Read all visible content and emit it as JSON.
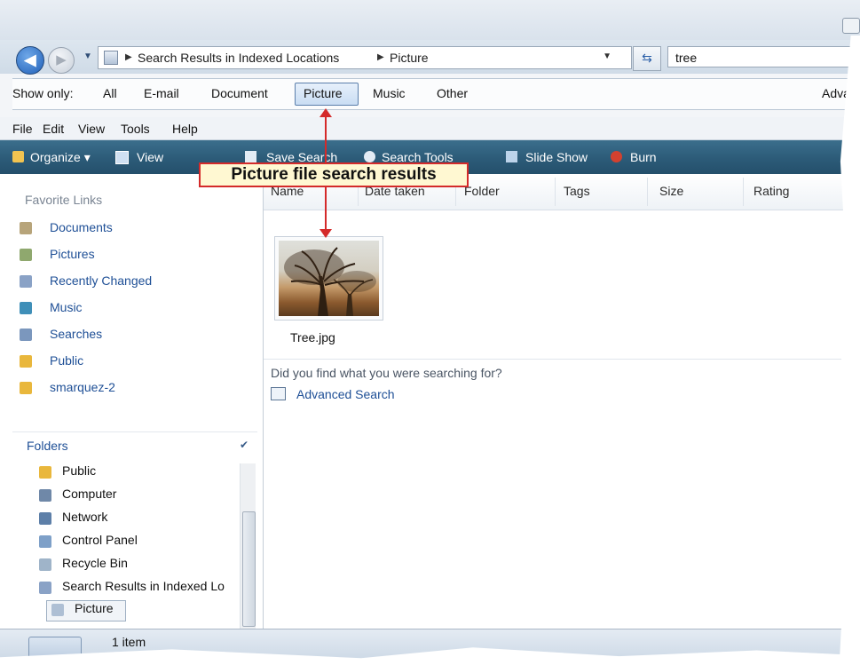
{
  "address": {
    "crumbs": [
      "Search Results in Indexed Locations",
      "Picture"
    ],
    "search_value": "tree"
  },
  "show_only": {
    "label": "Show only:",
    "items": [
      "All",
      "E-mail",
      "Document",
      "Picture",
      "Music",
      "Other"
    ],
    "selected": "Picture",
    "advanced": "Advan"
  },
  "menu": [
    "File",
    "Edit",
    "View",
    "Tools",
    "Help"
  ],
  "toolbar": {
    "organize": "Organize",
    "views": "View",
    "save_search": "Save Search",
    "search_tools": "Search Tools",
    "slide_show": "Slide Show",
    "burn": "Burn"
  },
  "favorites": {
    "header": "Favorite Links",
    "items": [
      "Documents",
      "Pictures",
      "Recently Changed",
      "Music",
      "Searches",
      "Public",
      "smarquez-2"
    ]
  },
  "folders": {
    "header": "Folders",
    "items": [
      "Public",
      "Computer",
      "Network",
      "Control Panel",
      "Recycle Bin",
      "Search Results in Indexed Lo",
      "Picture"
    ]
  },
  "columns": [
    "Name",
    "Date taken",
    "Folder",
    "Tags",
    "Size",
    "Rating"
  ],
  "files": [
    {
      "name": "Tree.jpg"
    }
  ],
  "hint": {
    "question": "Did you find what you were searching for?",
    "advanced_search": "Advanced Search"
  },
  "status": {
    "count": "1 item"
  },
  "callout": {
    "text": "Picture file search results"
  },
  "colors": {
    "toolbar": "#2c5b78",
    "link": "#1e4f96",
    "callout_border": "#d42a2a",
    "callout_fill": "#fff8d2"
  }
}
